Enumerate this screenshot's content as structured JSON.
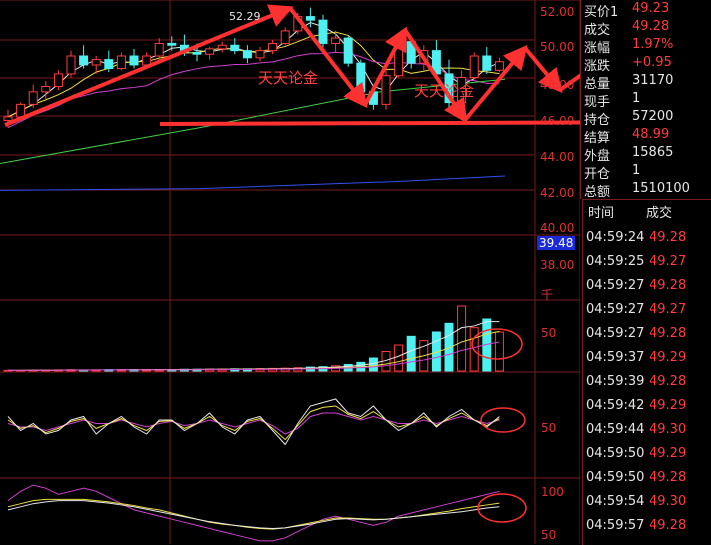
{
  "colors": {
    "up": "#ff3d3d",
    "down": "#4ef0f0",
    "grid": "#7a1a1a",
    "ma_white": "#e8e8e8",
    "ma_yellow": "#f0e040",
    "ma_magenta": "#d040d0",
    "ma_green": "#40d040",
    "ma_blue": "#3050f0",
    "highlight_bg": "#1a2ad8"
  },
  "price_axis": [
    "52.00",
    "50.00",
    "48.00",
    "46.00",
    "44.00",
    "42.00",
    "40.00",
    "39.48",
    "38.00"
  ],
  "volume_axis": {
    "unit": "千",
    "level": "50"
  },
  "indicator1_axis": {
    "level": "50"
  },
  "indicator2_axis": {
    "level": "100",
    "level2": "50"
  },
  "high_marker": "52.29",
  "annotations": {
    "watermark_left": "天天论金",
    "watermark_right": "天天论金"
  },
  "quote": [
    {
      "key": "买价1",
      "value": "49.23",
      "color": "#ff3d3d"
    },
    {
      "key": "成交",
      "value": "49.28",
      "color": "#ff3d3d"
    },
    {
      "key": "涨幅",
      "value": "1.97%",
      "color": "#ff3d3d"
    },
    {
      "key": "涨跌",
      "value": "+0.95",
      "color": "#ff3d3d"
    },
    {
      "key": "总量",
      "value": "31170",
      "color": "#e6e6e6"
    },
    {
      "key": "现手",
      "value": "1",
      "color": "#e6e6e6"
    },
    {
      "key": "持仓",
      "value": "57200",
      "color": "#e6e6e6"
    },
    {
      "key": "结算",
      "value": "48.99",
      "color": "#ff3d3d"
    },
    {
      "key": "外盘",
      "value": "15865",
      "color": "#e6e6e6"
    },
    {
      "key": "开仓",
      "value": "1",
      "color": "#e6e6e6"
    },
    {
      "key": "总额",
      "value": "1510100",
      "color": "#e6e6e6"
    }
  ],
  "ticks_header": {
    "time": "时间",
    "price": "成交"
  },
  "ticks": [
    {
      "time": "04:59:24",
      "price": "49.28"
    },
    {
      "time": "04:59:25",
      "price": "49.27"
    },
    {
      "time": "04:59:27",
      "price": "49.28"
    },
    {
      "time": "04:59:27",
      "price": "49.27"
    },
    {
      "time": "04:59:27",
      "price": "49.28"
    },
    {
      "time": "04:59:37",
      "price": "49.29"
    },
    {
      "time": "04:59:39",
      "price": "49.28"
    },
    {
      "time": "04:59:42",
      "price": "49.29"
    },
    {
      "time": "04:59:44",
      "price": "49.30"
    },
    {
      "time": "04:59:50",
      "price": "49.29"
    },
    {
      "time": "04:59:50",
      "price": "49.28"
    },
    {
      "time": "04:59:54",
      "price": "49.30"
    },
    {
      "time": "04:59:57",
      "price": "49.28"
    }
  ],
  "chart_data": {
    "type": "candlestick",
    "title": "",
    "ylim": [
      37.5,
      52.5
    ],
    "candles": [
      {
        "o": 46.0,
        "h": 46.6,
        "l": 45.6,
        "c": 46.2
      },
      {
        "o": 46.2,
        "h": 47.0,
        "l": 46.0,
        "c": 46.9
      },
      {
        "o": 46.9,
        "h": 48.0,
        "l": 46.7,
        "c": 47.6
      },
      {
        "o": 47.6,
        "h": 48.2,
        "l": 47.2,
        "c": 47.9
      },
      {
        "o": 47.9,
        "h": 48.8,
        "l": 47.7,
        "c": 48.6
      },
      {
        "o": 48.6,
        "h": 49.9,
        "l": 48.4,
        "c": 49.6
      },
      {
        "o": 49.6,
        "h": 50.2,
        "l": 48.9,
        "c": 49.1
      },
      {
        "o": 49.1,
        "h": 49.6,
        "l": 48.6,
        "c": 49.4
      },
      {
        "o": 49.4,
        "h": 49.9,
        "l": 48.7,
        "c": 48.9
      },
      {
        "o": 48.9,
        "h": 49.8,
        "l": 48.8,
        "c": 49.6
      },
      {
        "o": 49.6,
        "h": 50.0,
        "l": 48.9,
        "c": 49.1
      },
      {
        "o": 49.1,
        "h": 49.8,
        "l": 48.9,
        "c": 49.6
      },
      {
        "o": 49.6,
        "h": 50.6,
        "l": 49.4,
        "c": 50.3
      },
      {
        "o": 50.3,
        "h": 50.7,
        "l": 49.9,
        "c": 50.2
      },
      {
        "o": 50.2,
        "h": 50.8,
        "l": 49.6,
        "c": 49.8
      },
      {
        "o": 49.8,
        "h": 50.3,
        "l": 49.3,
        "c": 49.7
      },
      {
        "o": 49.7,
        "h": 50.1,
        "l": 49.4,
        "c": 50.0
      },
      {
        "o": 50.0,
        "h": 50.4,
        "l": 49.8,
        "c": 50.2
      },
      {
        "o": 50.2,
        "h": 50.6,
        "l": 49.7,
        "c": 49.9
      },
      {
        "o": 49.9,
        "h": 50.2,
        "l": 49.2,
        "c": 49.5
      },
      {
        "o": 49.5,
        "h": 50.1,
        "l": 49.3,
        "c": 49.9
      },
      {
        "o": 49.9,
        "h": 50.5,
        "l": 49.7,
        "c": 50.3
      },
      {
        "o": 50.3,
        "h": 51.2,
        "l": 50.2,
        "c": 51.0
      },
      {
        "o": 51.0,
        "h": 52.0,
        "l": 50.8,
        "c": 51.8
      },
      {
        "o": 51.8,
        "h": 52.3,
        "l": 51.2,
        "c": 51.6
      },
      {
        "o": 51.6,
        "h": 51.9,
        "l": 50.1,
        "c": 50.3
      },
      {
        "o": 50.3,
        "h": 51.0,
        "l": 49.8,
        "c": 50.6
      },
      {
        "o": 50.6,
        "h": 50.7,
        "l": 49.0,
        "c": 49.2
      },
      {
        "o": 49.2,
        "h": 49.4,
        "l": 47.2,
        "c": 47.6
      },
      {
        "o": 47.6,
        "h": 48.0,
        "l": 46.6,
        "c": 46.9
      },
      {
        "o": 46.9,
        "h": 48.8,
        "l": 46.6,
        "c": 48.5
      },
      {
        "o": 48.5,
        "h": 50.7,
        "l": 48.4,
        "c": 50.4
      },
      {
        "o": 50.4,
        "h": 50.6,
        "l": 48.9,
        "c": 49.2
      },
      {
        "o": 49.2,
        "h": 50.2,
        "l": 48.8,
        "c": 49.9
      },
      {
        "o": 49.9,
        "h": 50.5,
        "l": 48.3,
        "c": 48.6
      },
      {
        "o": 48.6,
        "h": 49.4,
        "l": 46.5,
        "c": 47.0
      },
      {
        "o": 47.0,
        "h": 48.8,
        "l": 46.8,
        "c": 48.4
      },
      {
        "o": 48.4,
        "h": 49.8,
        "l": 48.3,
        "c": 49.6
      },
      {
        "o": 49.6,
        "h": 50.1,
        "l": 48.6,
        "c": 48.8
      },
      {
        "o": 48.8,
        "h": 49.5,
        "l": 48.7,
        "c": 49.28
      }
    ],
    "volume": [
      0.3,
      0.3,
      0.4,
      0.4,
      0.5,
      0.6,
      0.5,
      0.5,
      0.6,
      0.6,
      0.6,
      0.7,
      0.7,
      0.7,
      0.8,
      0.8,
      0.9,
      0.9,
      1,
      1,
      1.1,
      1.2,
      1.3,
      1.5,
      1.8,
      2,
      2.4,
      3,
      4,
      6,
      9,
      12,
      16,
      14,
      18,
      22,
      30,
      20,
      24,
      18
    ],
    "ind1_white": [
      0.55,
      0.35,
      0.45,
      0.3,
      0.35,
      0.5,
      0.55,
      0.3,
      0.45,
      0.55,
      0.4,
      0.3,
      0.5,
      0.5,
      0.35,
      0.45,
      0.6,
      0.4,
      0.3,
      0.5,
      0.55,
      0.35,
      0.15,
      0.45,
      0.7,
      0.75,
      0.8,
      0.6,
      0.55,
      0.7,
      0.5,
      0.35,
      0.45,
      0.6,
      0.4,
      0.55,
      0.65,
      0.5,
      0.4,
      0.55
    ],
    "ind1_magenta": [
      0.45,
      0.4,
      0.4,
      0.35,
      0.4,
      0.45,
      0.5,
      0.45,
      0.45,
      0.5,
      0.45,
      0.4,
      0.45,
      0.48,
      0.42,
      0.45,
      0.5,
      0.45,
      0.4,
      0.45,
      0.5,
      0.42,
      0.3,
      0.38,
      0.55,
      0.6,
      0.6,
      0.55,
      0.5,
      0.55,
      0.5,
      0.45,
      0.45,
      0.5,
      0.45,
      0.5,
      0.55,
      0.5,
      0.45,
      0.5
    ],
    "ind1_yellow": [
      0.5,
      0.38,
      0.42,
      0.32,
      0.38,
      0.48,
      0.52,
      0.38,
      0.45,
      0.52,
      0.42,
      0.35,
      0.48,
      0.49,
      0.38,
      0.45,
      0.55,
      0.42,
      0.35,
      0.48,
      0.52,
      0.38,
      0.22,
      0.42,
      0.62,
      0.68,
      0.7,
      0.58,
      0.52,
      0.62,
      0.5,
      0.4,
      0.45,
      0.55,
      0.42,
      0.52,
      0.6,
      0.5,
      0.42,
      0.52
    ],
    "ind2_magenta": [
      0.7,
      0.85,
      0.95,
      0.9,
      0.8,
      0.85,
      0.9,
      0.85,
      0.75,
      0.65,
      0.55,
      0.5,
      0.45,
      0.4,
      0.35,
      0.3,
      0.25,
      0.2,
      0.15,
      0.1,
      0.05,
      0.05,
      0.1,
      0.2,
      0.3,
      0.4,
      0.45,
      0.4,
      0.35,
      0.3,
      0.35,
      0.45,
      0.5,
      0.55,
      0.6,
      0.65,
      0.7,
      0.75,
      0.8,
      0.85
    ],
    "ind2_yellow": [
      0.6,
      0.65,
      0.7,
      0.72,
      0.72,
      0.72,
      0.72,
      0.7,
      0.68,
      0.65,
      0.62,
      0.58,
      0.55,
      0.5,
      0.45,
      0.4,
      0.35,
      0.32,
      0.3,
      0.27,
      0.25,
      0.24,
      0.26,
      0.3,
      0.34,
      0.38,
      0.42,
      0.42,
      0.41,
      0.4,
      0.4,
      0.42,
      0.44,
      0.47,
      0.5,
      0.53,
      0.57,
      0.6,
      0.63,
      0.66
    ],
    "ind2_white": [
      0.55,
      0.6,
      0.65,
      0.68,
      0.7,
      0.7,
      0.7,
      0.68,
      0.66,
      0.63,
      0.6,
      0.56,
      0.52,
      0.48,
      0.44,
      0.4,
      0.36,
      0.33,
      0.3,
      0.28,
      0.26,
      0.25,
      0.26,
      0.29,
      0.32,
      0.36,
      0.4,
      0.41,
      0.4,
      0.39,
      0.4,
      0.42,
      0.44,
      0.46,
      0.48,
      0.5,
      0.52,
      0.55,
      0.58,
      0.6
    ]
  }
}
